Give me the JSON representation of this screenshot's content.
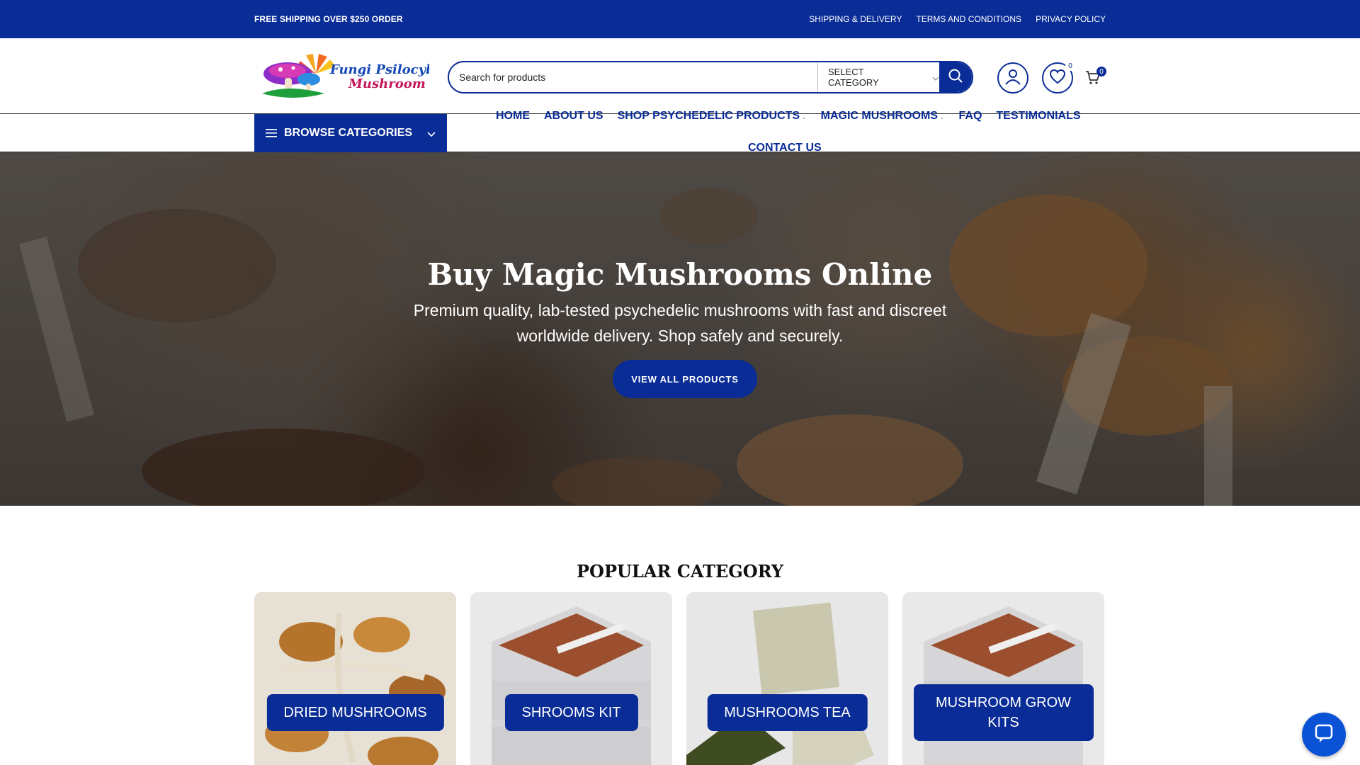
{
  "topbar": {
    "promo": "FREE SHIPPING OVER $250 ORDER",
    "links": [
      "SHIPPING & DELIVERY",
      "TERMS AND CONDITIONS",
      "PRIVACY POLICY"
    ]
  },
  "header": {
    "logo_line1": "Fungi Psilocybin",
    "logo_line2": "Mushroom",
    "search_placeholder": "Search for products",
    "category_select": "SELECT CATEGORY",
    "wishlist_count": "0",
    "cart_count": "0"
  },
  "nav": {
    "browse": "BROWSE CATEGORIES",
    "items": [
      "HOME",
      "ABOUT US",
      "SHOP PSYCHEDELIC PRODUCTS",
      "MAGIC MUSHROOMS",
      "FAQ",
      "TESTIMONIALS",
      "CONTACT US"
    ]
  },
  "hero": {
    "title": "Buy Magic Mushrooms Online",
    "subtitle": "Premium quality, lab-tested psychedelic mushrooms with fast and discreet worldwide delivery. Shop safely and securely.",
    "cta": "VIEW ALL PRODUCTS"
  },
  "popular": {
    "title": "POPULAR CATEGORY",
    "categories": [
      "DRIED MUSHROOMS",
      "SHROOMS KIT",
      "MUSHROOMS TEA",
      "MUSHROOM GROW KITS"
    ]
  },
  "colors": {
    "brand": "#0a2c96",
    "chat": "#0a52d6"
  },
  "icons": [
    "hamburger-icon",
    "chevron-down-icon",
    "search-icon",
    "user-icon",
    "heart-icon",
    "cart-icon",
    "chat-icon"
  ]
}
